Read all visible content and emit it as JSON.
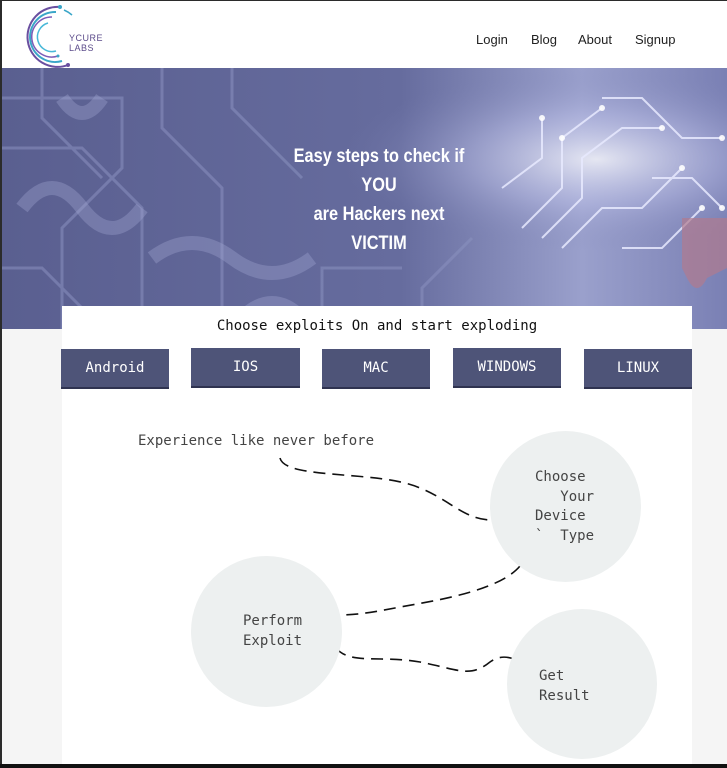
{
  "header": {
    "logo_text": "YCURE LABS",
    "nav": [
      "Login",
      "Blog",
      "About",
      "Signup"
    ]
  },
  "hero": {
    "title": "Easy steps to check if\nYOU\nare Hackers next\nVICTIM"
  },
  "card": {
    "heading": "Choose exploits On and start exploding",
    "os_buttons": [
      "Android",
      "IOS",
      "MAC",
      "WINDOWS",
      "LINUX"
    ],
    "tagline": "Experience like never before"
  },
  "steps": {
    "choose": "Choose\n   Your\nDevice\n`  Type",
    "perform": "Perform\nExploit",
    "result": "Get\nResult"
  },
  "colors": {
    "button_bg": "#4e5478",
    "hero_bg": "#5c6294",
    "circle_bg": "#edf0f0",
    "logo_accent": "#5b4b8a"
  }
}
